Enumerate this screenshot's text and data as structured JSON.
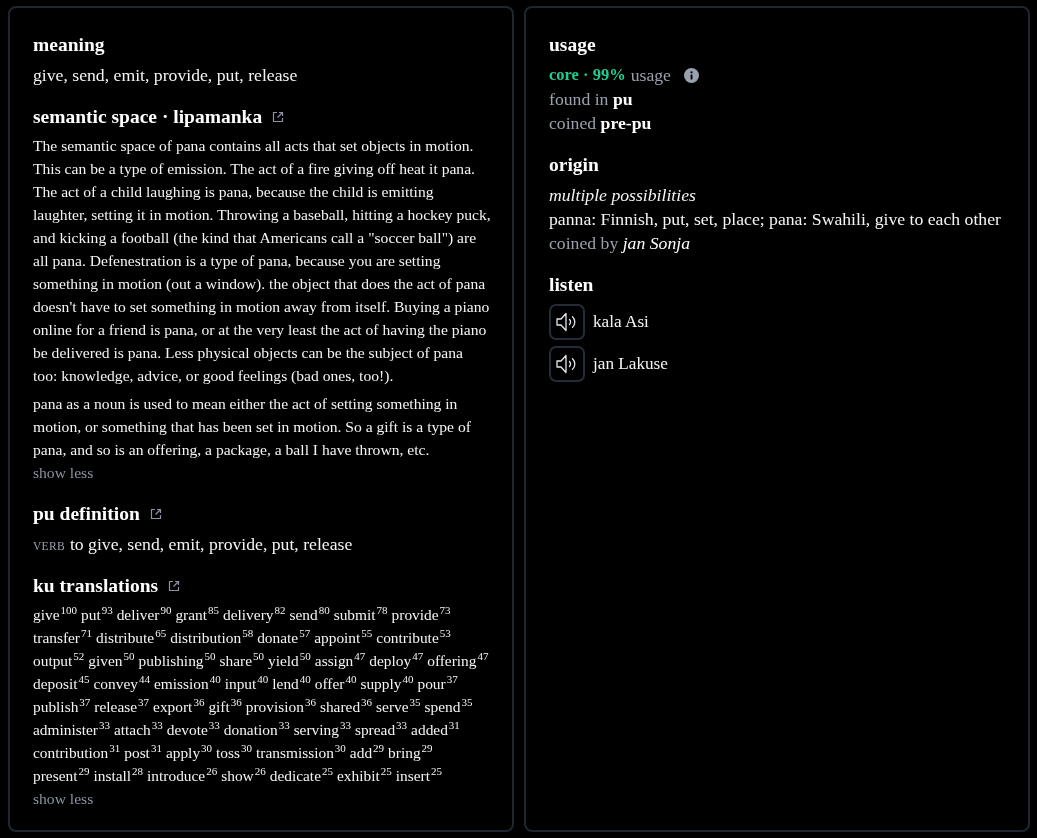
{
  "left_panel": {
    "meaning": {
      "heading": "meaning",
      "text": "give, send, emit, provide, put, release"
    },
    "semantic_space": {
      "heading": "semantic space · lipamanka",
      "external_link": true,
      "paragraphs": [
        "The semantic space of pana contains all acts that set objects in motion. This can be a type of emission. The act of a fire giving off heat it pana. The act of a child laughing is pana, because the child is emitting laughter, setting it in motion. Throwing a baseball, hitting a hockey puck, and kicking a football (the kind that Americans call a \"soccer ball\") are all pana. Defenestration is a type of pana, because you are setting something in motion (out a window). the object that does the act of pana doesn't have to set something in motion away from itself. Buying a piano online for a friend is pana, or at the very least the act of having the piano be delivered is pana. Less physical objects can be the subject of pana too: knowledge, advice, or good feelings (bad ones, too!).",
        "pana as a noun is used to mean either the act of setting something in motion, or something that has been set in motion. So a gift is a type of pana, and so is an offering, a package, a ball I have thrown, etc."
      ],
      "toggle": "show less"
    },
    "pu_definition": {
      "heading": "pu definition",
      "external_link": true,
      "part_of_speech": "VERB",
      "text": "to give, send, emit, provide, put, release"
    },
    "ku_translations": {
      "heading": "ku translations",
      "external_link": true,
      "items": [
        {
          "word": "give",
          "score": "100"
        },
        {
          "word": "put",
          "score": "93"
        },
        {
          "word": "deliver",
          "score": "90"
        },
        {
          "word": "grant",
          "score": "85"
        },
        {
          "word": "delivery",
          "score": "82"
        },
        {
          "word": "send",
          "score": "80"
        },
        {
          "word": "submit",
          "score": "78"
        },
        {
          "word": "provide",
          "score": "73"
        },
        {
          "word": "transfer",
          "score": "71"
        },
        {
          "word": "distribute",
          "score": "65"
        },
        {
          "word": "distribution",
          "score": "58"
        },
        {
          "word": "donate",
          "score": "57"
        },
        {
          "word": "appoint",
          "score": "55"
        },
        {
          "word": "contribute",
          "score": "53"
        },
        {
          "word": "output",
          "score": "52"
        },
        {
          "word": "given",
          "score": "50"
        },
        {
          "word": "publishing",
          "score": "50"
        },
        {
          "word": "share",
          "score": "50"
        },
        {
          "word": "yield",
          "score": "50"
        },
        {
          "word": "assign",
          "score": "47"
        },
        {
          "word": "deploy",
          "score": "47"
        },
        {
          "word": "offering",
          "score": "47"
        },
        {
          "word": "deposit",
          "score": "45"
        },
        {
          "word": "convey",
          "score": "44"
        },
        {
          "word": "emission",
          "score": "40"
        },
        {
          "word": "input",
          "score": "40"
        },
        {
          "word": "lend",
          "score": "40"
        },
        {
          "word": "offer",
          "score": "40"
        },
        {
          "word": "supply",
          "score": "40"
        },
        {
          "word": "pour",
          "score": "37"
        },
        {
          "word": "publish",
          "score": "37"
        },
        {
          "word": "release",
          "score": "37"
        },
        {
          "word": "export",
          "score": "36"
        },
        {
          "word": "gift",
          "score": "36"
        },
        {
          "word": "provision",
          "score": "36"
        },
        {
          "word": "shared",
          "score": "36"
        },
        {
          "word": "serve",
          "score": "35"
        },
        {
          "word": "spend",
          "score": "35"
        },
        {
          "word": "administer",
          "score": "33"
        },
        {
          "word": "attach",
          "score": "33"
        },
        {
          "word": "devote",
          "score": "33"
        },
        {
          "word": "donation",
          "score": "33"
        },
        {
          "word": "serving",
          "score": "33"
        },
        {
          "word": "spread",
          "score": "33"
        },
        {
          "word": "added",
          "score": "31"
        },
        {
          "word": "contribution",
          "score": "31"
        },
        {
          "word": "post",
          "score": "31"
        },
        {
          "word": "apply",
          "score": "30"
        },
        {
          "word": "toss",
          "score": "30"
        },
        {
          "word": "transmission",
          "score": "30"
        },
        {
          "word": "add",
          "score": "29"
        },
        {
          "word": "bring",
          "score": "29"
        },
        {
          "word": "present",
          "score": "29"
        },
        {
          "word": "install",
          "score": "28"
        },
        {
          "word": "introduce",
          "score": "26"
        },
        {
          "word": "show",
          "score": "26"
        },
        {
          "word": "dedicate",
          "score": "25"
        },
        {
          "word": "exhibit",
          "score": "25"
        },
        {
          "word": "insert",
          "score": "25"
        }
      ],
      "toggle": "show less"
    }
  },
  "right_panel": {
    "usage": {
      "heading": "usage",
      "category": "core · 99%",
      "label": "usage",
      "found_in": "found in **pu**",
      "coined": "coined **pre-pu**"
    },
    "origin": {
      "heading": "origin",
      "note": "multiple possibilities",
      "text": "panna: Finnish, put, set, place; pana: Swahili, give to each other",
      "coined_by": "coined by *jan Sonja*"
    },
    "listen": {
      "heading": "listen",
      "recordings": [
        {
          "speaker": "kala Asi"
        },
        {
          "speaker": "jan Lakuse"
        }
      ]
    }
  }
}
